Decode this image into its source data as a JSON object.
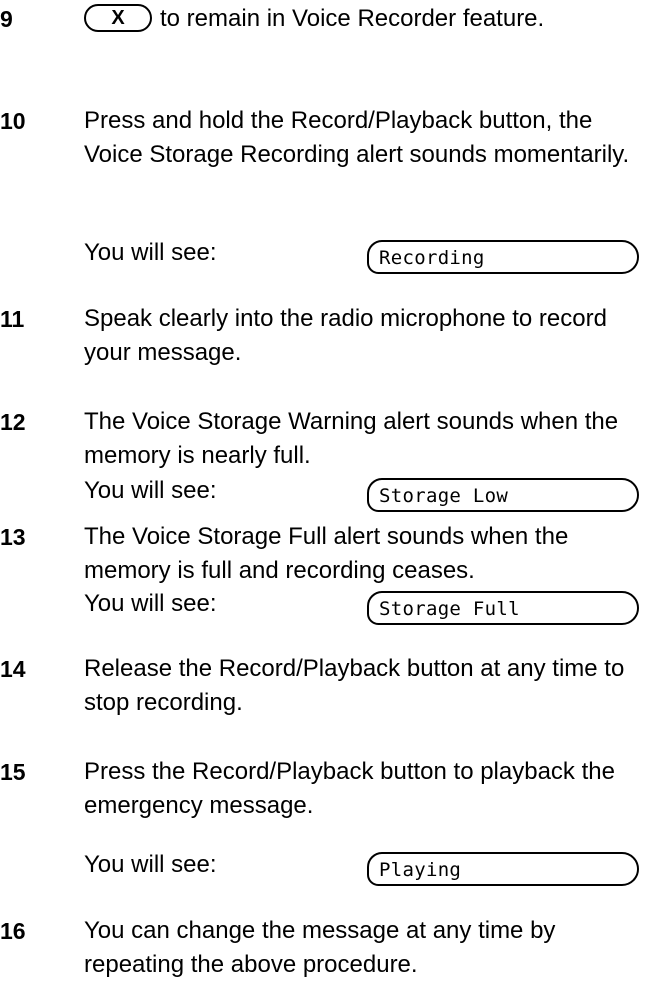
{
  "key_x_label": "X",
  "steps": [
    {
      "number": "9",
      "text": "to remain in Voice Recorder feature."
    },
    {
      "number": "10",
      "text": "Press and hold the Record/Playback button, the Voice Storage Recording alert sounds momentarily.",
      "see_label": "You will see:",
      "display": "Recording"
    },
    {
      "number": "11",
      "text": "Speak clearly into the radio microphone to record your message."
    },
    {
      "number": "12",
      "text": "The Voice Storage Warning alert sounds when the memory is nearly full.",
      "see_label": "You will see:",
      "display": "Storage Low"
    },
    {
      "number": "13",
      "text": "The Voice Storage Full alert sounds when the memory is full and recording ceases.",
      "see_label": "You will see:",
      "display": "Storage Full"
    },
    {
      "number": "14",
      "text": "Release the Record/Playback button at any time to stop recording."
    },
    {
      "number": "15",
      "text": "Press the Record/Playback button to playback the emergency message.",
      "see_label": "You will see:",
      "display": "Playing"
    },
    {
      "number": "16",
      "text": "You can change the message at any time by repeating the above procedure."
    }
  ]
}
